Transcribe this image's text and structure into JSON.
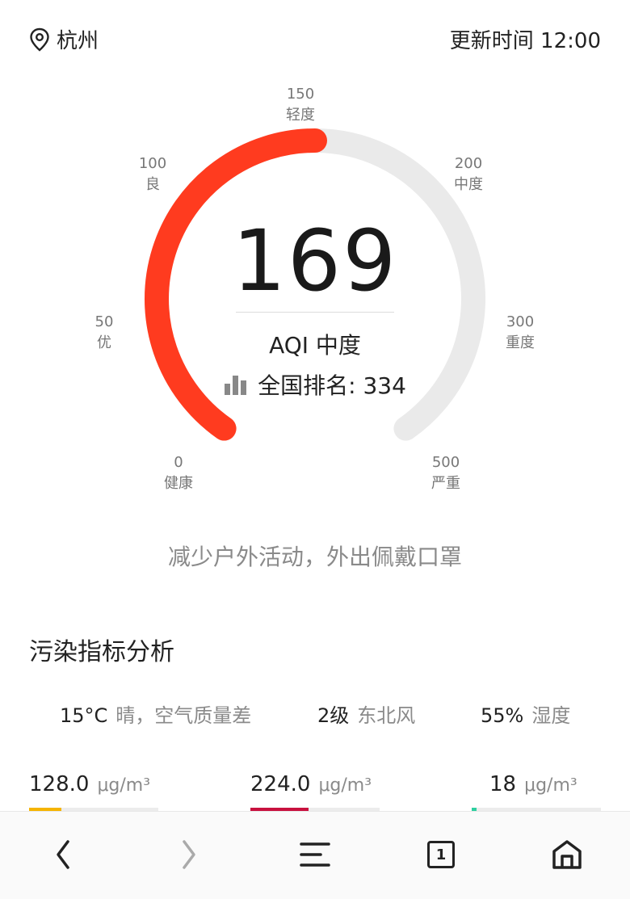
{
  "header": {
    "city": "杭州",
    "update_time": "更新时间 12:00"
  },
  "gauge": {
    "ticks": [
      {
        "value": "0",
        "label": "健康"
      },
      {
        "value": "50",
        "label": "优"
      },
      {
        "value": "100",
        "label": "良"
      },
      {
        "value": "150",
        "label": "轻度"
      },
      {
        "value": "200",
        "label": "中度"
      },
      {
        "value": "300",
        "label": "重度"
      },
      {
        "value": "500",
        "label": "严重"
      }
    ],
    "aqi": "169",
    "level": "AQI 中度",
    "rank": "全国排名: 334",
    "fill_fraction": 0.5,
    "colors": {
      "fill": "#ff3b1f",
      "track": "#eaeaea"
    }
  },
  "advice": "减少户外活动，外出佩戴口罩",
  "analysis": {
    "title": "污染指标分析",
    "weather": [
      {
        "value": "15°C",
        "label": "晴，空气质量差"
      },
      {
        "value": "2级",
        "label": "东北风"
      },
      {
        "value": "55%",
        "label": "湿度"
      }
    ],
    "pollutants": [
      {
        "value": "128.0",
        "unit": "μg/m³",
        "level": 0.25,
        "color": "#f5b400"
      },
      {
        "value": "224.0",
        "unit": "μg/m³",
        "level": 0.45,
        "color": "#c8103e"
      },
      {
        "value": "18",
        "unit": "μg/m³",
        "level": 0.04,
        "color": "#2ecfa0"
      }
    ]
  },
  "nav": {
    "tab_count": "1"
  }
}
